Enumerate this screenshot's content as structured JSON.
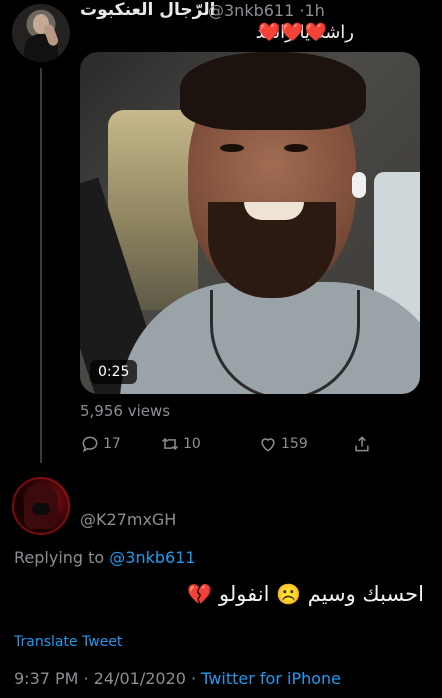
{
  "original_tweet": {
    "display_name": "الرّجال العنكبوت",
    "handle": "@3nkb611",
    "separator": "·",
    "time_ago": "1h",
    "text": "راشد يا راشد",
    "hearts": "❤️❤️❤️",
    "video": {
      "duration": "0:25"
    },
    "views": "5,956 views",
    "actions": {
      "reply_count": "17",
      "retweet_count": "10",
      "like_count": "159"
    }
  },
  "reply": {
    "handle": "@K27mxGH",
    "replying_prefix": "Replying to ",
    "replying_to": "@3nkb611",
    "text_part1": "احسبك وسيم",
    "emoji1": "☹️",
    "text_part2": "انفولو",
    "emoji2": "💔",
    "translate_label": "Translate Tweet",
    "timestamp": "9:37 PM · 24/01/2020 · ",
    "source": "Twitter for iPhone"
  },
  "colors": {
    "background": "#000000",
    "link": "#1d9bf0",
    "muted": "#8b8f94",
    "heart": "#e0245e"
  }
}
